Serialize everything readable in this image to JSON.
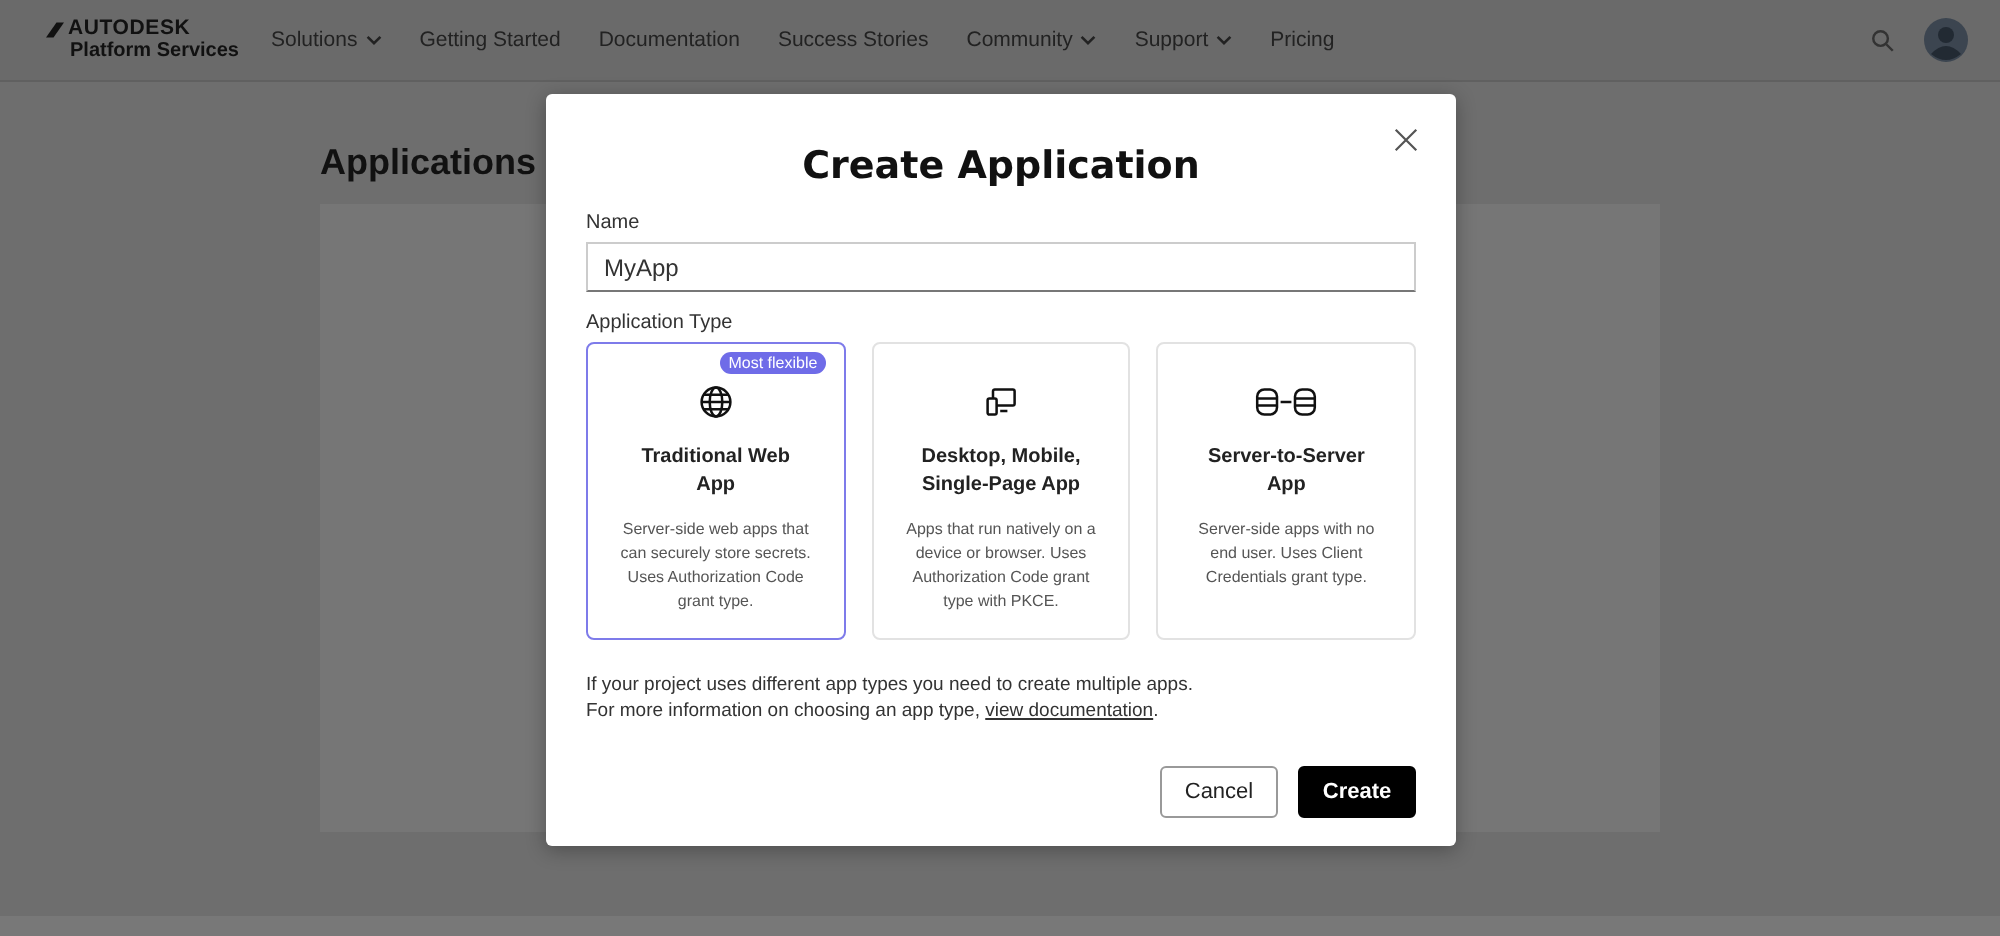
{
  "brand": {
    "line1": "AUTODESK",
    "line2": "Platform Services"
  },
  "nav": [
    {
      "label": "Solutions",
      "dropdown": true
    },
    {
      "label": "Getting Started",
      "dropdown": false
    },
    {
      "label": "Documentation",
      "dropdown": false
    },
    {
      "label": "Success Stories",
      "dropdown": false
    },
    {
      "label": "Community",
      "dropdown": true
    },
    {
      "label": "Support",
      "dropdown": true
    },
    {
      "label": "Pricing",
      "dropdown": false
    }
  ],
  "page": {
    "title": "Applications"
  },
  "dialog": {
    "title": "Create Application",
    "name_label": "Name",
    "name_value": "MyApp",
    "type_label": "Application Type",
    "app_types": [
      {
        "kind": "web",
        "title": "Traditional Web App",
        "badge": "Most flexible",
        "description": "Server-side web apps that can securely store secrets. Uses Authorization Code grant type.",
        "selected": true
      },
      {
        "kind": "desktop",
        "title": "Desktop, Mobile, Single-Page App",
        "description": "Apps that run natively on a device or browser. Uses Authorization Code grant type with PKCE.",
        "selected": false
      },
      {
        "kind": "server",
        "title": "Server-to-Server App",
        "description": "Server-side apps with no end user. Uses Client Credentials grant type.",
        "selected": false
      }
    ],
    "note1": "If your project uses different app types you need to create multiple apps.",
    "note2": "For more information on choosing an app type,",
    "link": "view documentation",
    "note_end": ".",
    "cancel": "Cancel",
    "create": "Create"
  }
}
